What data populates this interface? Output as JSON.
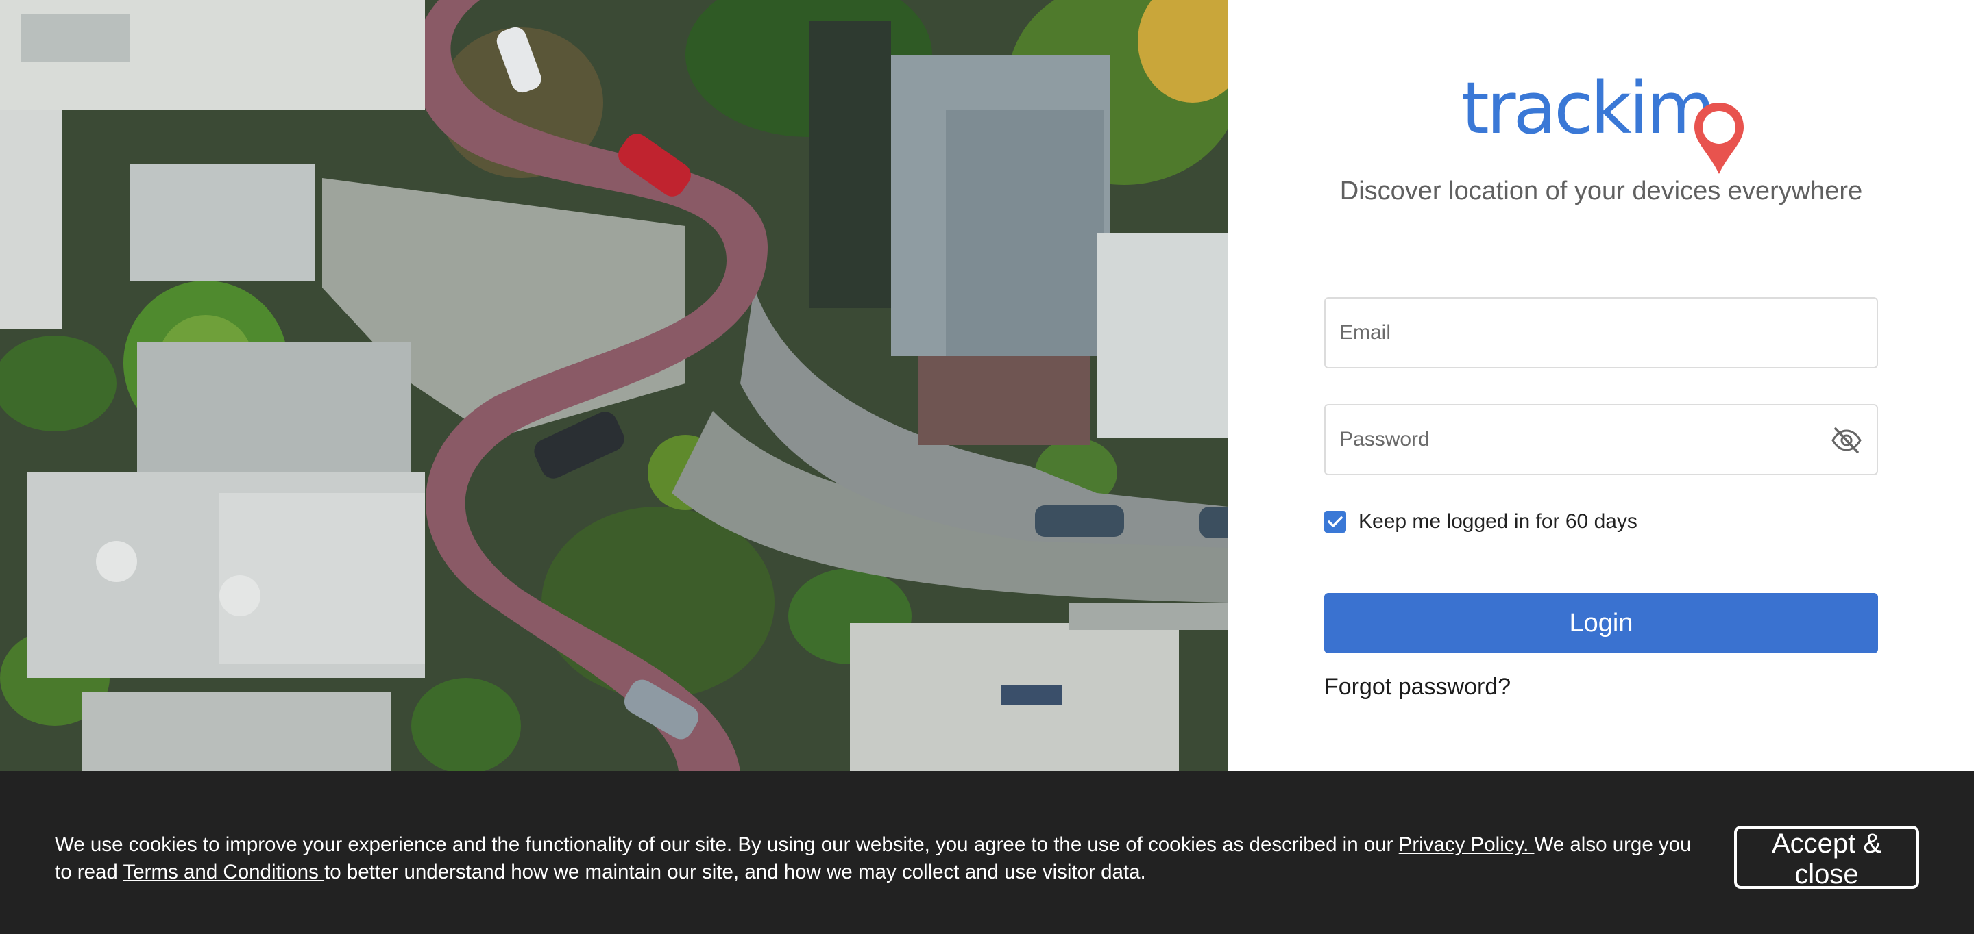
{
  "hero": {
    "alt": "Aerial view of a winding street with cars and houses"
  },
  "brand": {
    "logo_text": "trackimo",
    "logo_main": "trackim",
    "tagline": "Discover location of your devices everywhere"
  },
  "login": {
    "email_placeholder": "Email",
    "password_placeholder": "Password",
    "remember_label": "Keep me logged in for 60 days",
    "remember_checked": true,
    "submit_label": "Login",
    "forgot_label": "Forgot password?"
  },
  "cookie_banner": {
    "text_1": "We use cookies to improve your experience and the functionality of our site. By using our website, you agree to the use of cookies as described in our ",
    "privacy_link": "Privacy Policy. ",
    "text_2": "We also urge you to read ",
    "terms_link": "Terms and Conditions ",
    "text_3": "to better understand how we maintain our site, and how we may collect and use visitor data.",
    "accept_label": "Accept & close"
  },
  "colors": {
    "brand_blue": "#3a78d6",
    "pin_red": "#e8534e",
    "banner_bg": "#222222"
  }
}
